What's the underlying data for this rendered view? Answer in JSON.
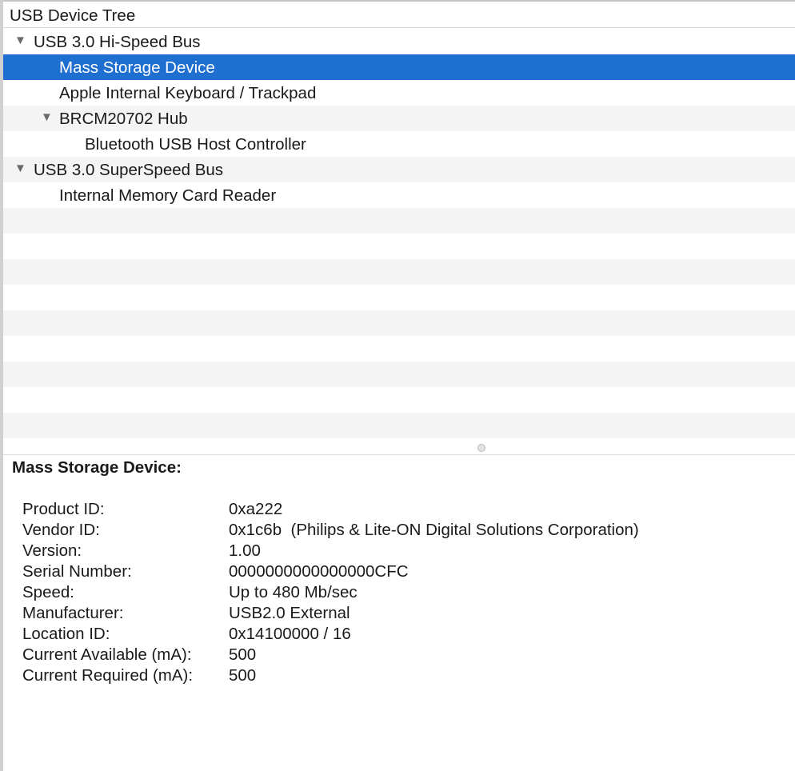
{
  "tree": {
    "header": "USB Device Tree",
    "rows": [
      {
        "label": "USB 3.0 Hi-Speed Bus",
        "expanded": true,
        "triangle": "▼"
      },
      {
        "label": "Mass Storage Device",
        "selected": true
      },
      {
        "label": "Apple Internal Keyboard / Trackpad"
      },
      {
        "label": "BRCM20702 Hub",
        "expanded": true,
        "triangle": "▼"
      },
      {
        "label": "Bluetooth USB Host Controller"
      },
      {
        "label": "USB 3.0 SuperSpeed Bus",
        "expanded": true,
        "triangle": "▼"
      },
      {
        "label": "Internal Memory Card Reader"
      }
    ]
  },
  "detail": {
    "title": "Mass Storage Device:",
    "properties": [
      {
        "key": "Product ID:",
        "value": "0xa222"
      },
      {
        "key": "Vendor ID:",
        "value": "0x1c6b  (Philips & Lite-ON Digital Solutions Corporation)"
      },
      {
        "key": "Version:",
        "value": "1.00"
      },
      {
        "key": "Serial Number:",
        "value": "0000000000000000CFC"
      },
      {
        "key": "Speed:",
        "value": "Up to 480 Mb/sec"
      },
      {
        "key": "Manufacturer:",
        "value": "USB2.0 External"
      },
      {
        "key": "Location ID:",
        "value": "0x14100000 / 16"
      },
      {
        "key": "Current Available (mA):",
        "value": "500"
      },
      {
        "key": "Current Required (mA):",
        "value": "500"
      }
    ]
  },
  "colors": {
    "selection": "#1f6fd1",
    "alternate_row": "#f4f4f4",
    "text": "#1a1a1a"
  }
}
